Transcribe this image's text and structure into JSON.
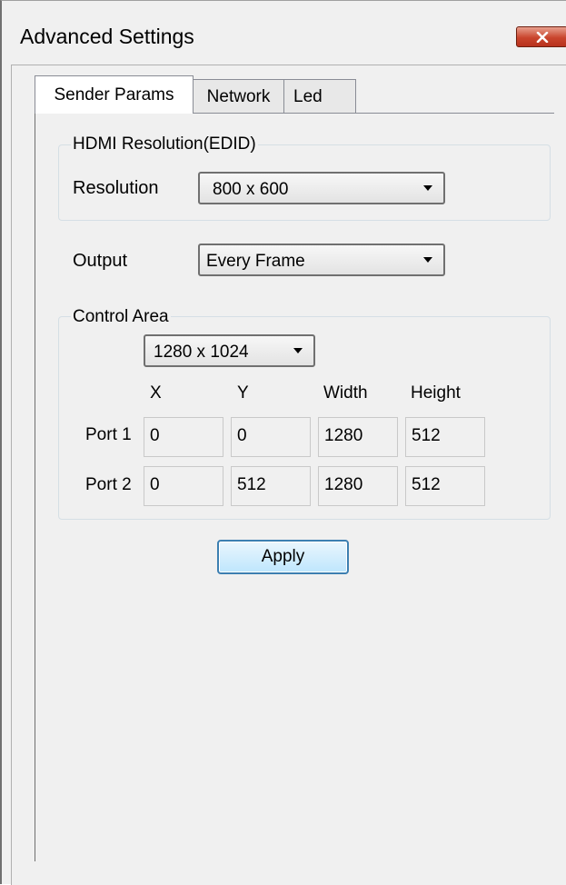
{
  "window": {
    "title": "Advanced Settings",
    "close_icon": "close-icon"
  },
  "tabs": [
    {
      "label": "Sender Params",
      "active": true
    },
    {
      "label": "Network",
      "active": false
    },
    {
      "label": "Led",
      "active": false
    }
  ],
  "hdmi_group": {
    "title": "HDMI Resolution(EDID)",
    "resolution_label": "Resolution",
    "resolution_value": "800 x 600"
  },
  "output": {
    "label": "Output",
    "value": "Every Frame"
  },
  "control_area": {
    "title": "Control Area",
    "size_value": "1280 x 1024",
    "columns": [
      "X",
      "Y",
      "Width",
      "Height"
    ],
    "rows": [
      {
        "label": "Port 1",
        "values": [
          "0",
          "0",
          "1280",
          "512"
        ]
      },
      {
        "label": "Port 2",
        "values": [
          "0",
          "512",
          "1280",
          "512"
        ]
      }
    ]
  },
  "apply_label": "Apply",
  "colors": {
    "accent_border": "#3c7fb1",
    "close_button": "#c9452d",
    "window_bg": "#f0f0f0"
  }
}
